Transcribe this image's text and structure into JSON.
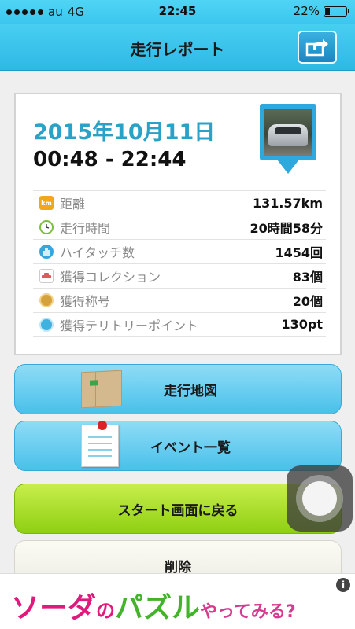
{
  "status": {
    "carrier": "au",
    "network": "4G",
    "time": "22:45",
    "battery": "22%",
    "battery_level": 0.22
  },
  "nav": {
    "title": "走行レポート"
  },
  "report": {
    "date": "2015年10月11日",
    "time_range": "00:48 - 22:44",
    "rows": [
      {
        "label": "距離",
        "value": "131.57km",
        "icon": "km-icon",
        "icon_text": "km",
        "color": "#f0a81a"
      },
      {
        "label": "走行時間",
        "value": "20時間58分",
        "icon": "clock-icon",
        "icon_text": "",
        "color": "#7cbf3a"
      },
      {
        "label": "ハイタッチ数",
        "value": "1454回",
        "icon": "hand-icon",
        "icon_text": "",
        "color": "#37a6dc"
      },
      {
        "label": "獲得コレクション",
        "value": "83個",
        "icon": "car-icon",
        "icon_text": "",
        "color": "#e05a5a"
      },
      {
        "label": "獲得称号",
        "value": "20個",
        "icon": "medal-icon",
        "icon_text": "",
        "color": "#d4a13a"
      },
      {
        "label": "獲得テリトリーポイント",
        "value": "130pt",
        "icon": "territory-icon",
        "icon_text": "",
        "color": "#3fb2e0"
      }
    ]
  },
  "buttons": {
    "map": "走行地図",
    "events": "イベント一覧",
    "back_to_start": "スタート画面に戻る",
    "delete": "削除"
  },
  "ad": {
    "part1": "ソーダ",
    "part2": "の",
    "part3": "パズル",
    "part4": "やってみる?",
    "info": "i"
  }
}
